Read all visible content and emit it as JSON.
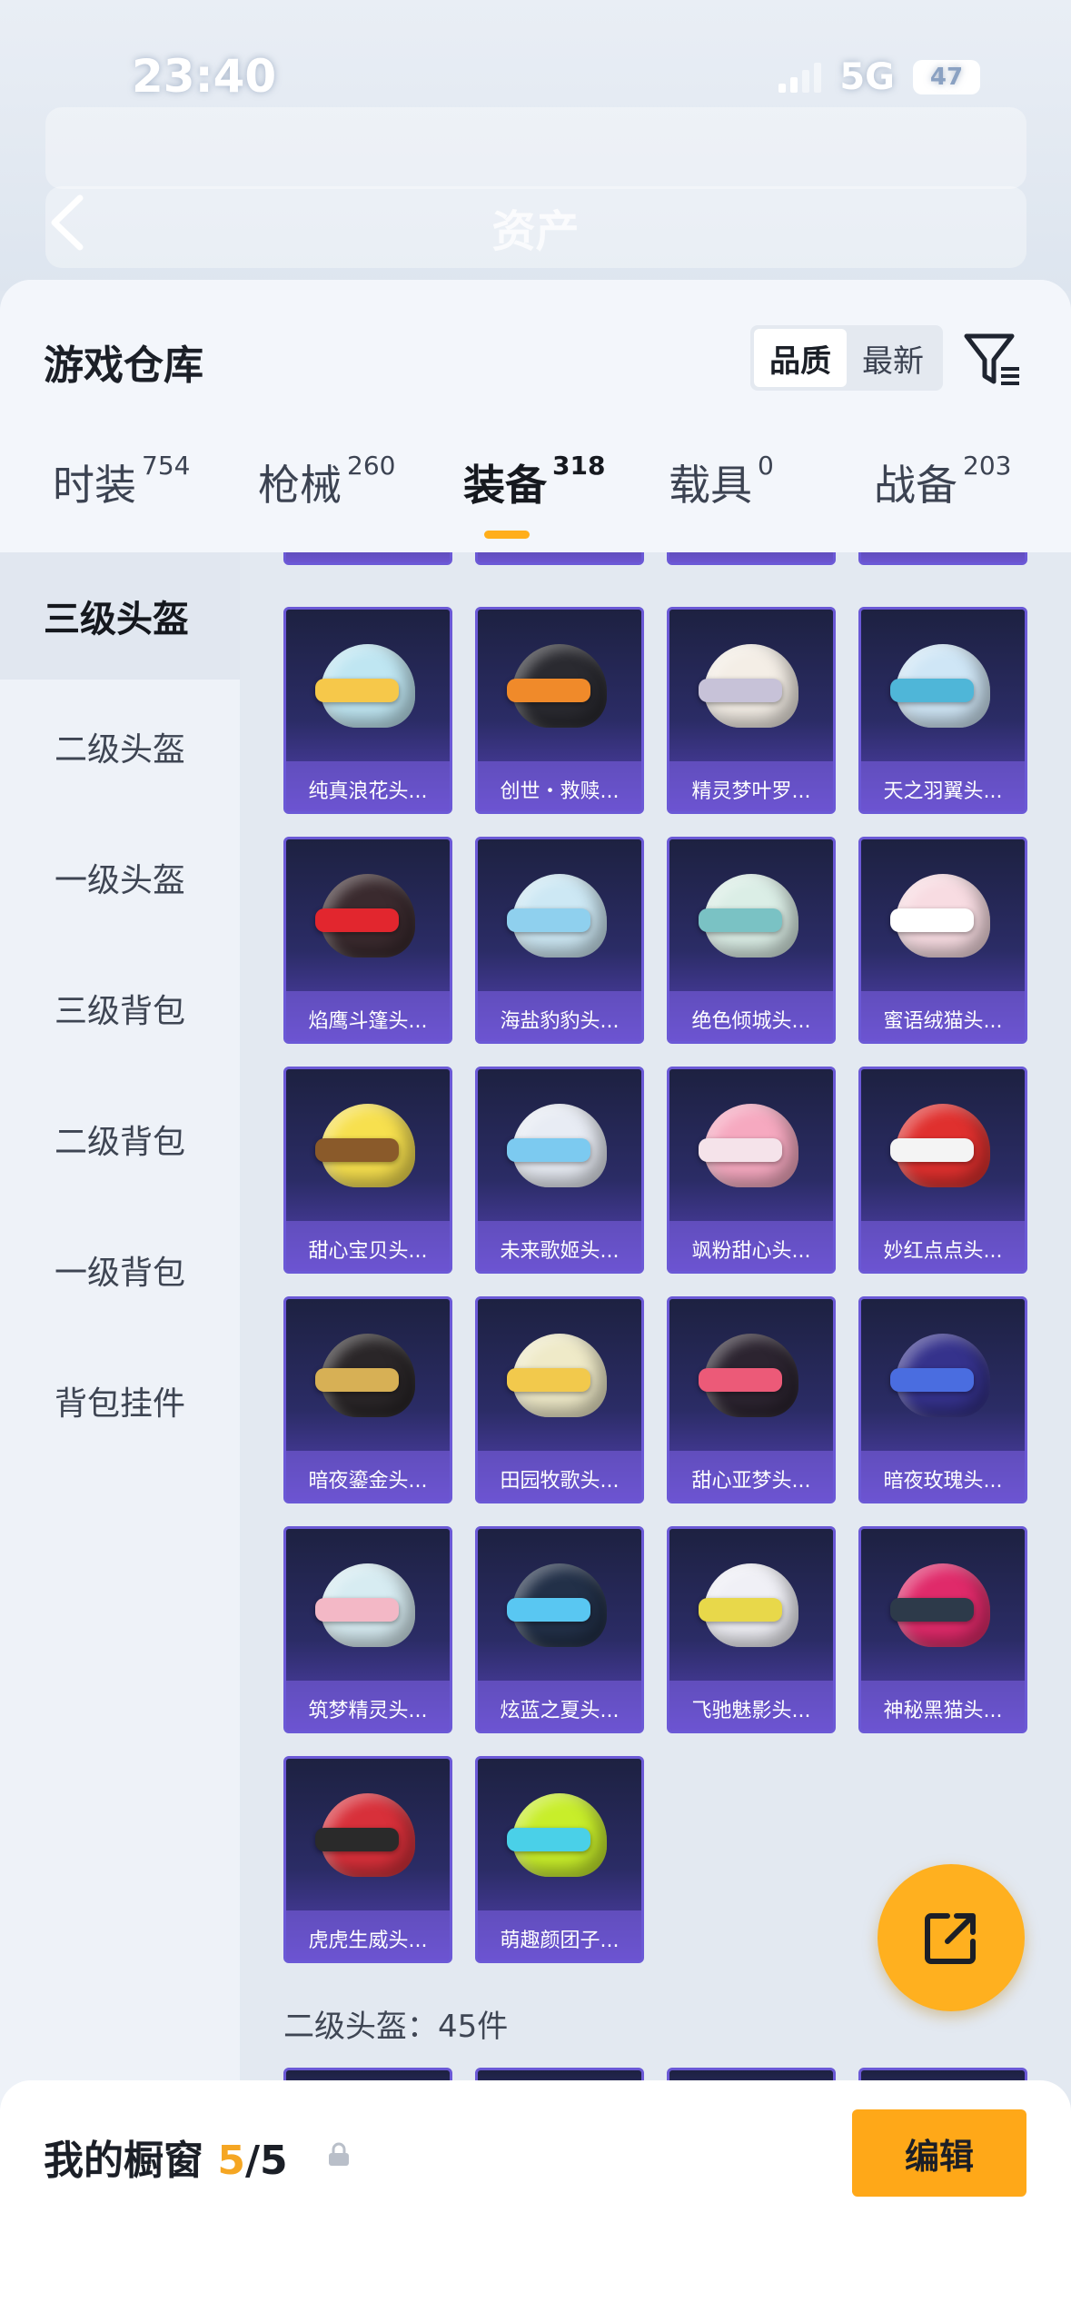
{
  "status": {
    "time": "23:40",
    "network": "5G",
    "battery": "47"
  },
  "page": {
    "title": "资产"
  },
  "sheet": {
    "title": "游戏仓库",
    "sort_options": [
      "品质",
      "最新"
    ],
    "sort_active": "品质"
  },
  "tabs": [
    {
      "label": "时装",
      "count": "754"
    },
    {
      "label": "枪械",
      "count": "260"
    },
    {
      "label": "装备",
      "count": "318"
    },
    {
      "label": "载具",
      "count": "0"
    },
    {
      "label": "战备",
      "count": "203"
    }
  ],
  "active_tab": "装备",
  "sidebar": [
    "三级头盔",
    "二级头盔",
    "一级头盔",
    "三级背包",
    "二级背包",
    "一级背包",
    "背包挂件"
  ],
  "sidebar_active": "三级头盔",
  "items": [
    {
      "name": "纯真浪花头...",
      "dome": "#bfe6f2",
      "visor": "#f6c84a"
    },
    {
      "name": "创世・救赎...",
      "dome": "#2a2a30",
      "visor": "#f08a2a"
    },
    {
      "name": "精灵梦叶罗...",
      "dome": "#f4eee6",
      "visor": "#c7c2d8"
    },
    {
      "name": "天之羽翼头...",
      "dome": "#cfe6f6",
      "visor": "#4fb6d8"
    },
    {
      "name": "焰鹰斗篷头...",
      "dome": "#3a2a2e",
      "visor": "#e2262e"
    },
    {
      "name": "海盐豹豹头...",
      "dome": "#cde8f4",
      "visor": "#8fd0ee"
    },
    {
      "name": "绝色倾城头...",
      "dome": "#dbeee6",
      "visor": "#7ac2c4"
    },
    {
      "name": "蜜语绒猫头...",
      "dome": "#f8dce2",
      "visor": "#ffffff"
    },
    {
      "name": "甜心宝贝头...",
      "dome": "#f7e04e",
      "visor": "#8a5a2a"
    },
    {
      "name": "未来歌姬头...",
      "dome": "#e8ecf4",
      "visor": "#7ccaf0"
    },
    {
      "name": "飒粉甜心头...",
      "dome": "#f6a9c0",
      "visor": "#f5e3ea"
    },
    {
      "name": "妙红点点头...",
      "dome": "#e0302e",
      "visor": "#f4f4f4"
    },
    {
      "name": "暗夜鎏金头...",
      "dome": "#2a2628",
      "visor": "#d7b055"
    },
    {
      "name": "田园牧歌头...",
      "dome": "#efeac8",
      "visor": "#f2c94c"
    },
    {
      "name": "甜心亚梦头...",
      "dome": "#2c2430",
      "visor": "#ec5a78"
    },
    {
      "name": "暗夜玫瑰头...",
      "dome": "#35328c",
      "visor": "#4a6de0"
    },
    {
      "name": "筑梦精灵头...",
      "dome": "#d7ecf2",
      "visor": "#f3b8c6"
    },
    {
      "name": "炫蓝之夏头...",
      "dome": "#223048",
      "visor": "#59c7f2"
    },
    {
      "name": "飞驰魅影头...",
      "dome": "#f0f0f6",
      "visor": "#e8d84a"
    },
    {
      "name": "神秘黑猫头...",
      "dome": "#e02a6a",
      "visor": "#2d3a4a"
    },
    {
      "name": "虎虎生威头...",
      "dome": "#d8303a",
      "visor": "#2a2a2a"
    },
    {
      "name": "萌趣颜团子...",
      "dome": "#c8ee2a",
      "visor": "#4ad0e8"
    }
  ],
  "next_section": "二级头盔：45件",
  "bottom": {
    "title": "我的橱窗",
    "current": "5",
    "total": "/5",
    "edit_label": "编辑"
  },
  "accent": "#ffae1a",
  "rarity_color": "#6b59d6"
}
